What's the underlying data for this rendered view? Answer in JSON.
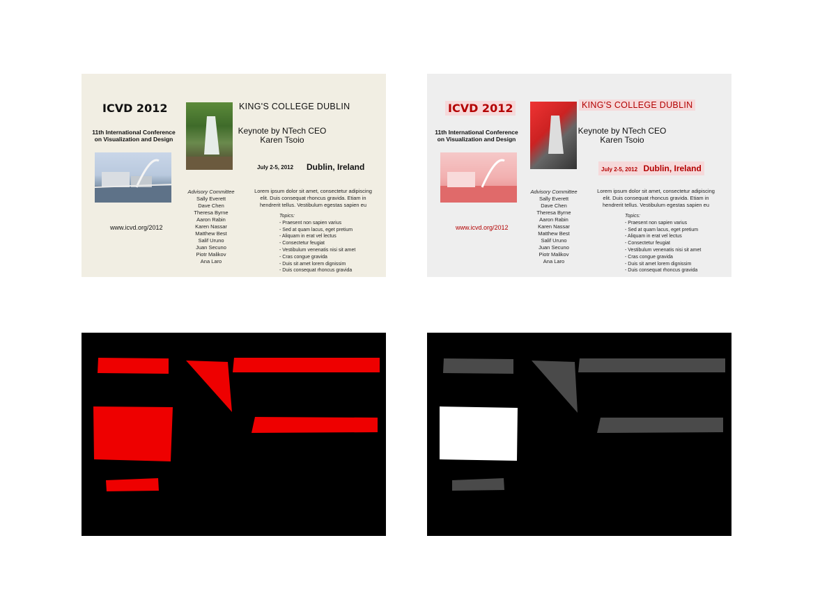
{
  "poster": {
    "title": "ICVD 2012",
    "conference_line1": "11th International Conference",
    "conference_line2": "on Visualization and Design",
    "college": "KING'S COLLEGE DUBLIN",
    "keynote_line1": "Keynote by NTech CEO",
    "keynote_line2": "Karen Tsoio",
    "dates": "July 2-5, 2012",
    "city": "Dublin, Ireland",
    "url": "www.icvd.org/2012",
    "committee_heading": "Advisory Committee",
    "committee": [
      "Sally Everett",
      "Dave Chen",
      "Theresa Byrne",
      "Aaron Rabin",
      "Karen Nassar",
      "Matthew Best",
      "Salif Uruno",
      "Juan Secuno",
      "Piotr Malikov",
      "Ana Laro"
    ],
    "lorem_line1": "Lorem ipsum dolor sit amet, consectetur adipiscing",
    "lorem_line2": "elit. Duis consequat rhoncus gravida. Etiam in",
    "lorem_line3": "hendrerit tellus. Vestibulum egestas sapien eu",
    "topics_heading": "Topics:",
    "topics": [
      "- Praesent non sapien varius",
      "- Sed at quam lacus, eget pretium",
      "- Aliquam in erat vel lectus",
      "- Consectetur feugiat",
      "- Vestibulum venenatis nisi sit amet",
      "- Cras congue gravida",
      "- Duis sit amet lorem dignissim",
      "- Duis consequat rhoncus gravida"
    ]
  },
  "colors": {
    "poster_bg": "#f1eee3",
    "highlight_bg": "#eeeeee",
    "highlight_red": "#b30000",
    "mask_red": "#ee0000",
    "mask_white": "#ffffff",
    "mask_gray": "#4a4a4a",
    "mask_bg": "#000000"
  }
}
